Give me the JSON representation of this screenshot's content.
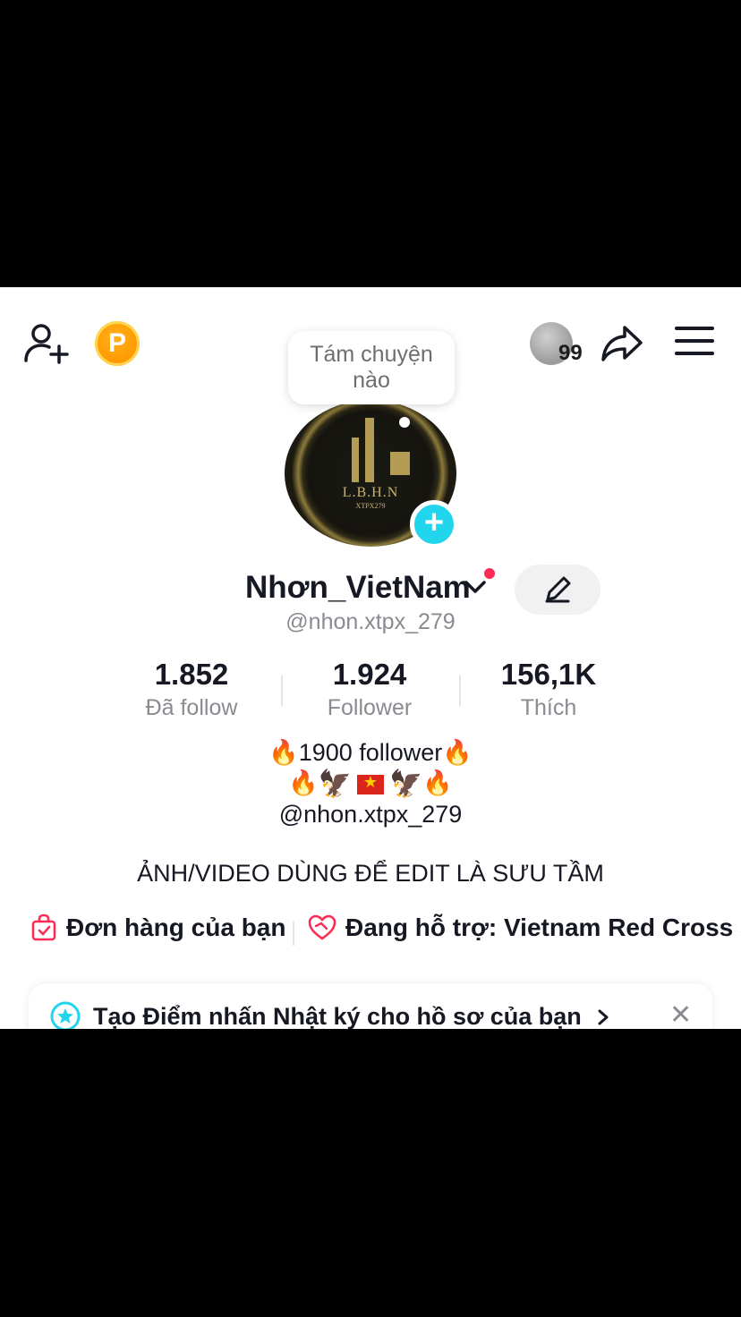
{
  "bubble": {
    "text_line1": "Tám chuyện",
    "text_line2": "nào"
  },
  "topbar": {
    "coin_letter": "P",
    "visitor_count": "99"
  },
  "avatar": {
    "line1": "L.B.H.N",
    "line2": "XTPX279"
  },
  "profile": {
    "display_name": "Nhơn_VietNam",
    "username": "@nhon.xtpx_279"
  },
  "stats": [
    {
      "value": "1.852",
      "label": "Đã follow"
    },
    {
      "value": "1.924",
      "label": "Follower"
    },
    {
      "value": "156,1K",
      "label": "Thích"
    }
  ],
  "bio": {
    "line1": "🔥1900 follower🔥",
    "line3": "@nhon.xtpx_279",
    "line4": "ẢNH/VIDEO DÙNG ĐỂ EDIT LÀ SƯU TẦM"
  },
  "links": {
    "orders_label": "Đơn hàng của bạn",
    "support_label": "Đang hỗ trợ: Vietnam Red Cross S"
  },
  "banner": {
    "text": "Tạo Điểm nhấn Nhật ký cho hồ sơ của bạn",
    "close": "✕"
  },
  "colors": {
    "accent_cyan": "#20d5ec",
    "red_dot": "#fe2c55",
    "coin": "#ff9b00"
  }
}
